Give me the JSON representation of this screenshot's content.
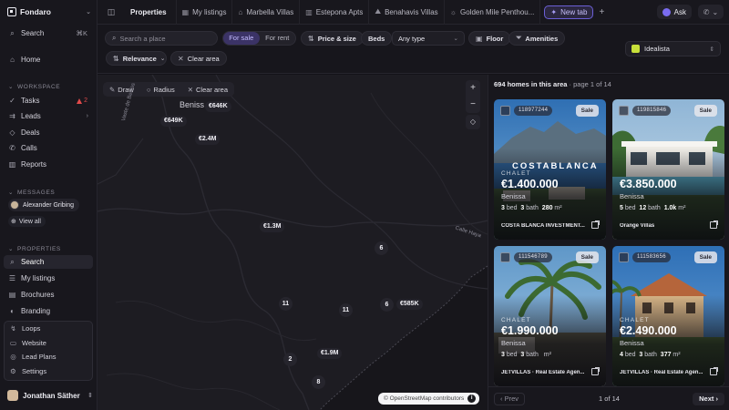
{
  "sidebar": {
    "brand": "Fondaro",
    "search_label": "Search",
    "search_shortcut": "⌘K",
    "home_label": "Home",
    "workspace_heading": "WORKSPACE",
    "tasks_label": "Tasks",
    "tasks_badge": "2",
    "leads_label": "Leads",
    "deals_label": "Deals",
    "calls_label": "Calls",
    "reports_label": "Reports",
    "messages_heading": "MESSAGES",
    "contact_name": "Alexander Gribing",
    "view_all_label": "View all",
    "properties_heading": "PROPERTIES",
    "prop_search_label": "Search",
    "my_listings_label": "My listings",
    "brochures_label": "Brochures",
    "branding_label": "Branding",
    "popup": [
      "Loops",
      "Website",
      "Lead Plans",
      "Settings"
    ],
    "user_name": "Jonathan Säther"
  },
  "tabs": {
    "items": [
      {
        "label": "Properties"
      },
      {
        "label": "My listings"
      },
      {
        "label": "Marbella Villas"
      },
      {
        "label": "Estepona Apts"
      },
      {
        "label": "Benahavis Villas"
      },
      {
        "label": "Golden Mile Penthou..."
      },
      {
        "label": "New tab"
      }
    ],
    "ask_label": "Ask"
  },
  "filters": {
    "search_placeholder": "Search a place",
    "for_sale": "For sale",
    "for_rent": "For rent",
    "price_size": "Price & size",
    "beds": "Beds",
    "any_type": "Any type",
    "floor": "Floor",
    "amenities": "Amenities",
    "sort": "Relevance",
    "clear_area": "Clear area",
    "source": "Idealista"
  },
  "map": {
    "tools": {
      "draw": "Draw",
      "radius": "Radius",
      "clear": "Clear area"
    },
    "place_label": "Beniss",
    "road_labels": [
      "Vaste de Beniss",
      "Calle Haya"
    ],
    "prices": [
      "€646K",
      "€649K",
      "€2.4M",
      "€1.3M",
      "€585K",
      "€1.9M"
    ],
    "clusters": [
      "6",
      "11",
      "11",
      "6",
      "2",
      "8"
    ],
    "attribution": "© OpenStreetMap contributors"
  },
  "results": {
    "count": "694 homes in this area",
    "page_info": "· page 1 of 14",
    "prev_label": "Prev",
    "page_label": "1 of 14",
    "next_label": "Next",
    "colors": {
      "sky": "#3d7fc0",
      "villa_white": "#e8e6df",
      "pool": "#6cc7e0",
      "palm_green": "#3f6b35"
    },
    "cards": [
      {
        "ref": "118977244",
        "status": "Sale",
        "type": "CHALET",
        "price": "€1.400.000",
        "town": "Benissa",
        "beds": "3",
        "baths": "3",
        "size": "280",
        "agency": "COSTA BLANCA INVESTMENT...",
        "overlay": "COSTABLANCA"
      },
      {
        "ref": "119815846",
        "status": "Sale",
        "type": "",
        "price": "€3.850.000",
        "town": "Benissa",
        "beds": "5",
        "baths": "12",
        "size": "1.0k",
        "agency": "Orange Villas",
        "overlay": ""
      },
      {
        "ref": "111546789",
        "status": "Sale",
        "type": "CHALET",
        "price": "€1.990.000",
        "town": "Benissa",
        "beds": "3",
        "baths": "3",
        "size": "",
        "agency": "JETVILLAS · Real Estate Agen...",
        "overlay": ""
      },
      {
        "ref": "111583656",
        "status": "Sale",
        "type": "CHALET",
        "price": "€2.490.000",
        "town": "Benissa",
        "beds": "4",
        "baths": "3",
        "size": "377",
        "agency": "JETVILLAS · Real Estate Agen...",
        "overlay": ""
      }
    ]
  }
}
